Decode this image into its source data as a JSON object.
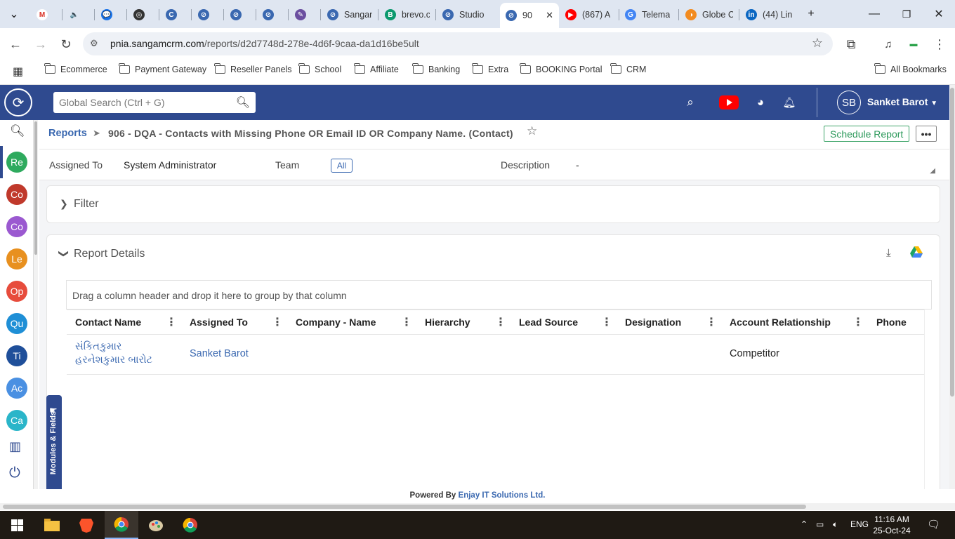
{
  "browser": {
    "tabs": [
      {
        "title": "",
        "fav": "M",
        "color": "#ffffff"
      },
      {
        "title": "",
        "fav": "🔈",
        "color": "#dfe6f1"
      },
      {
        "title": "",
        "fav": "💬",
        "color": "#1a73e8"
      },
      {
        "title": "",
        "fav": "◎",
        "color": "#333333"
      },
      {
        "title": "",
        "fav": "C",
        "color": "#3a68b0"
      },
      {
        "title": "",
        "fav": "⊘",
        "color": "#3a68b0"
      },
      {
        "title": "",
        "fav": "⊘",
        "color": "#3a68b0"
      },
      {
        "title": "",
        "fav": "⊘",
        "color": "#3a68b0"
      },
      {
        "title": "",
        "fav": "✎",
        "color": "#6b4fa0"
      },
      {
        "title": "Sangan",
        "fav": "⊘",
        "color": "#3a68b0"
      },
      {
        "title": "brevo.c",
        "fav": "B",
        "color": "#0b996e"
      },
      {
        "title": "Studio",
        "fav": "⊘",
        "color": "#3a68b0"
      },
      {
        "title": "90",
        "fav": "⊘",
        "color": "#3a68b0"
      },
      {
        "title": "(867) A",
        "fav": "▶",
        "color": "#ff0000"
      },
      {
        "title": "Telema",
        "fav": "G",
        "color": "#4285f4"
      },
      {
        "title": "Globe C",
        "fav": "◑",
        "color": "#f28b20"
      },
      {
        "title": "(44) Lin",
        "fav": "in",
        "color": "#0a66c2"
      }
    ],
    "url_host": "pnia.sangamcrm.com",
    "url_path": "/reports/d2d7748d-278e-4d6f-9caa-da1d16be5ult",
    "bookmarks": [
      "Ecommerce",
      "Payment Gateway",
      "Reseller Panels",
      "School",
      "Affiliate",
      "Banking",
      "Extra",
      "BOOKING Portal",
      "CRM"
    ],
    "all_bookmarks": "All Bookmarks"
  },
  "header": {
    "search_placeholder": "Global Search (Ctrl + G)",
    "avatar_initials": "SB",
    "user_name": "Sanket Barot"
  },
  "sidebar": {
    "modules": [
      {
        "label": "Re",
        "color": "#2eaa5e"
      },
      {
        "label": "Co",
        "color": "#c0392b"
      },
      {
        "label": "Co",
        "color": "#9b59d0"
      },
      {
        "label": "Le",
        "color": "#e8901f"
      },
      {
        "label": "Op",
        "color": "#e74c3c"
      },
      {
        "label": "Qu",
        "color": "#1f8fd6"
      },
      {
        "label": "Ti",
        "color": "#1f4f9a"
      },
      {
        "label": "Ac",
        "color": "#4a90e2"
      },
      {
        "label": "Ca",
        "color": "#2ab5c9"
      }
    ]
  },
  "report": {
    "breadcrumb": "Reports",
    "title": "906 - DQA - Contacts with Missing Phone OR Email ID OR Company Name.  (Contact)",
    "schedule_label": "Schedule Report",
    "more_label": "•••",
    "assigned_to_label": "Assigned To",
    "assigned_to_value": "System Administrator",
    "team_label": "Team",
    "team_value": "All",
    "description_label": "Description",
    "description_value": "-",
    "filter_label": "Filter",
    "details_label": "Report Details",
    "group_hint": "Drag a column header and drop it here to group by that column",
    "columns": [
      "Contact Name",
      "Assigned To",
      "Company - Name",
      "Hierarchy",
      "Lead Source",
      "Designation",
      "Account Relationship",
      "Phone"
    ],
    "rows": [
      {
        "contact_name_line1": "સંકિતકુમાર",
        "contact_name_line2": "હરનેશકુમાર બારોટ",
        "assigned_to": "Sanket Barot",
        "account_relationship": "Competitor"
      }
    ],
    "modules_tab": "Modules & Fields"
  },
  "footer": {
    "prefix": "Powered By",
    "company": "Enjay IT Solutions Ltd."
  },
  "taskbar": {
    "language": "ENG",
    "time": "11:16 AM",
    "date": "25-Oct-24"
  }
}
